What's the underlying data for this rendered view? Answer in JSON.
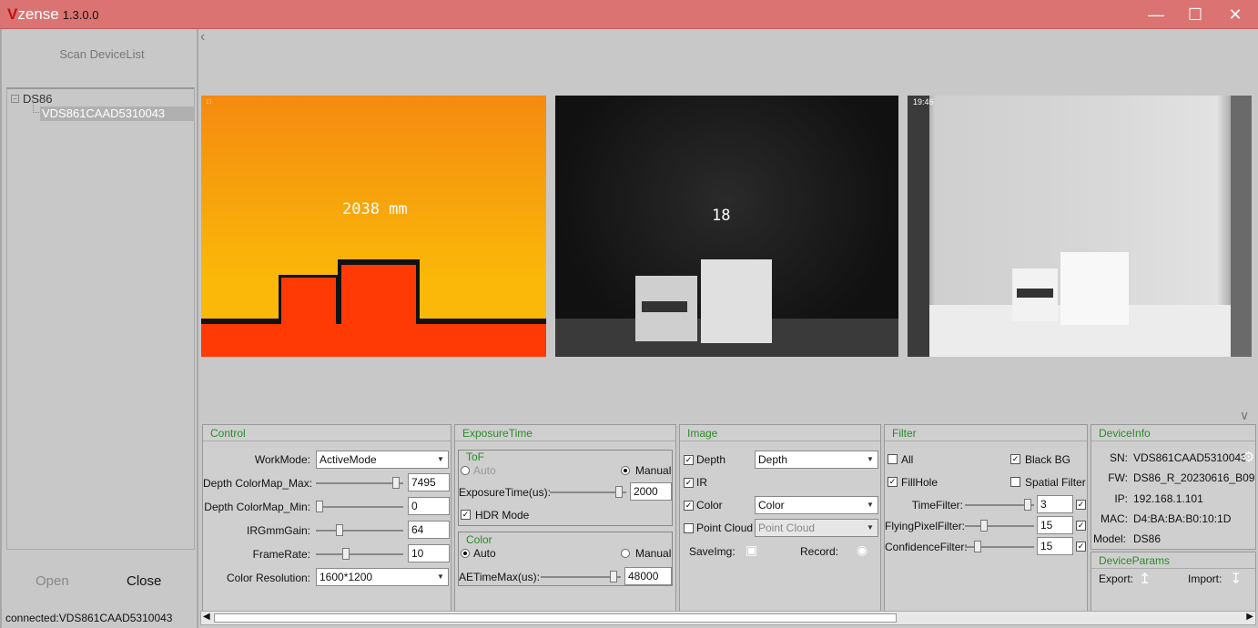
{
  "window": {
    "brand_v": "V",
    "brand_rest": "zense",
    "version": "1.3.0.0",
    "min_symbol": "—",
    "max_symbol": "☐",
    "close_symbol": "✕"
  },
  "left": {
    "scan_label": "Scan DeviceList",
    "tree_root": "DS86",
    "tree_child": "VDS861CAAD5310043",
    "open_label": "Open",
    "close_label": "Close",
    "status": "connected:VDS861CAAD5310043"
  },
  "viewer": {
    "back_icon": "chevron-left-icon",
    "collapse_icon": "chevron-down-icon",
    "depth_readout": "2038  mm",
    "ir_readout": "18",
    "color_timestamp": "19:46"
  },
  "control": {
    "title": "Control",
    "workmode_label": "WorkMode:",
    "workmode_value": "ActiveMode",
    "depth_max_label": "Depth ColorMap_Max:",
    "depth_max_value": "7495",
    "depth_max_level": 0.95,
    "depth_min_label": "Depth ColorMap_Min:",
    "depth_min_value": "0",
    "depth_min_level": 0.0,
    "irgain_label": "IRGmmGain:",
    "irgain_value": "64",
    "irgain_level": 0.25,
    "framerate_label": "FrameRate:",
    "framerate_value": "10",
    "framerate_level": 0.33,
    "colorres_label": "Color Resolution:",
    "colorres_value": "1600*1200"
  },
  "exposure": {
    "title": "ExposureTime",
    "tof_title": "ToF",
    "auto_label": "Auto",
    "manual_label": "Manual",
    "exptime_label": "ExposureTime(us):",
    "exptime_value": "2000",
    "exptime_level": 0.95,
    "hdr_label": "HDR Mode",
    "color_title": "Color",
    "color_auto_label": "Auto",
    "color_manual_label": "Manual",
    "aetmax_label": "AETimeMax(us):",
    "aetmax_value": "48000",
    "aetmax_level": 0.95
  },
  "image": {
    "title": "Image",
    "depth_label": "Depth",
    "depth_select": "Depth",
    "ir_label": "IR",
    "color_label": "Color",
    "color_select": "Color",
    "pc_label": "Point Cloud",
    "pc_select": "Point Cloud",
    "saveimg_label": "SaveImg:",
    "record_label": "Record:"
  },
  "filter": {
    "title": "Filter",
    "all_label": "All",
    "blackbg_label": "Black BG",
    "fillhole_label": "FillHole",
    "spatial_label": "Spatial Filter",
    "time_label": "TimeFilter:",
    "time_value": "3",
    "time_level": 0.95,
    "flying_label": "FlyingPixelFilter:",
    "flying_value": "15",
    "flying_level": 0.25,
    "conf_label": "ConfidenceFilter:",
    "conf_value": "15",
    "conf_level": 0.15
  },
  "deviceinfo": {
    "title": "DeviceInfo",
    "sn_label": "SN:",
    "sn_value": "VDS861CAAD5310043",
    "fw_label": "FW:",
    "fw_value": "DS86_R_20230616_B09",
    "ip_label": "IP:",
    "ip_value": "192.168.1.101",
    "mac_label": "MAC:",
    "mac_value": "D4:BA:BA:B0:10:1D",
    "model_label": "Model:",
    "model_value": "DS86"
  },
  "deviceparams": {
    "title": "DeviceParams",
    "export_label": "Export:",
    "import_label": "Import:"
  }
}
